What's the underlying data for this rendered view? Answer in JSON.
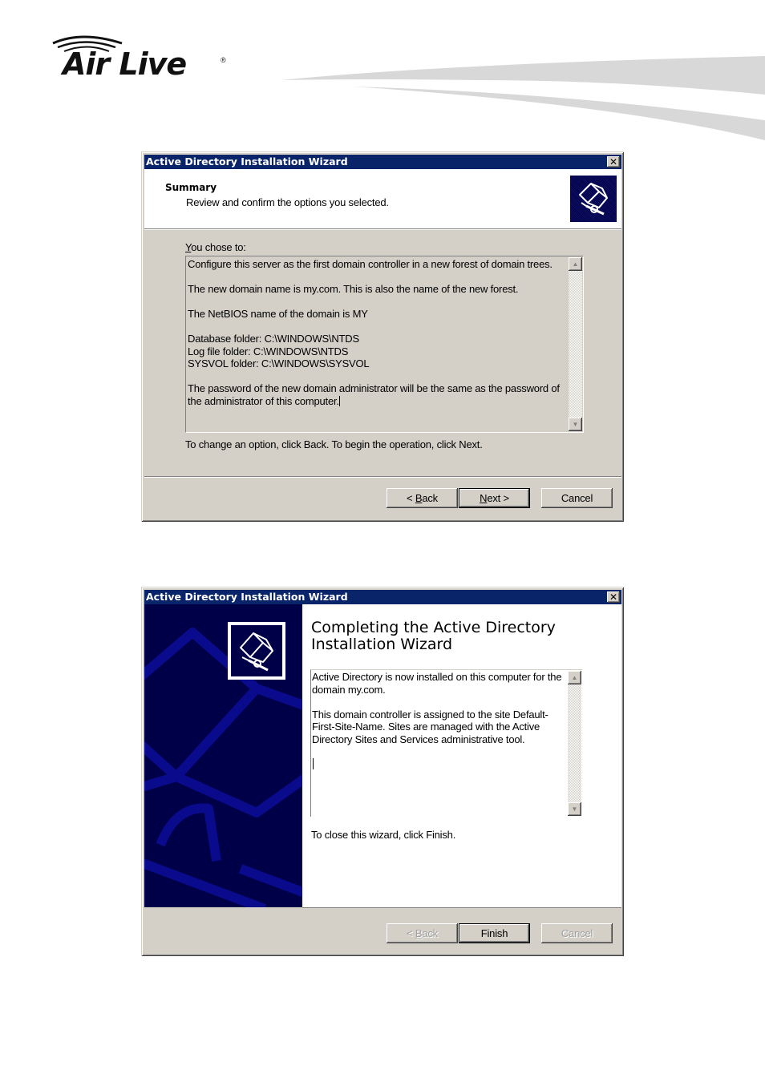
{
  "brand": {
    "logo_text": "Air Live",
    "registered_mark": "®"
  },
  "dialogs": [
    {
      "title": "Active Directory Installation Wizard",
      "close_glyph": "✕",
      "header": {
        "title": "Summary",
        "subtitle": "Review and confirm the options you selected.",
        "icon": "directory-book-icon"
      },
      "chose_label_accel": "Y",
      "chose_label_rest": "ou chose to:",
      "summary_lines": [
        "Configure this server as the first domain controller in a new forest of domain trees.",
        "The new domain name is my.com. This is also the name of the new forest.",
        "The NetBIOS name of the domain is MY",
        "Database folder: C:\\WINDOWS\\NTDS",
        "Log file folder: C:\\WINDOWS\\NTDS",
        "SYSVOL folder: C:\\WINDOWS\\SYSVOL",
        "The password of the new domain administrator will be the same as the password of the administrator of this computer."
      ],
      "instruction": "To change an option, click Back. To begin the operation, click Next.",
      "buttons": {
        "back_prefix": "< ",
        "back_accel": "B",
        "back_rest": "ack",
        "next_accel": "N",
        "next_rest": "ext >",
        "cancel": "Cancel"
      }
    },
    {
      "title": "Active Directory Installation Wizard",
      "close_glyph": "✕",
      "heading": "Completing the Active Directory Installation Wizard",
      "info_lines": [
        "Active Directory is now installed on this computer for the domain my.com.",
        "This domain controller is assigned to the site Default-First-Site-Name. Sites are managed with the Active Directory Sites and Services administrative tool."
      ],
      "instruction": "To close this wizard, click Finish.",
      "buttons": {
        "back_prefix": "< ",
        "back_accel": "B",
        "back_rest": "ack",
        "finish": "Finish",
        "cancel": "Cancel",
        "back_enabled": false,
        "cancel_enabled": false
      }
    }
  ],
  "scroll_arrows": {
    "up": "▲",
    "down": "▼"
  },
  "colors": {
    "titlebar": "#0a246a",
    "dialog_face": "#d4d0c8",
    "side_panel": "#000048",
    "side_panel_art": "#0a0a8c"
  }
}
